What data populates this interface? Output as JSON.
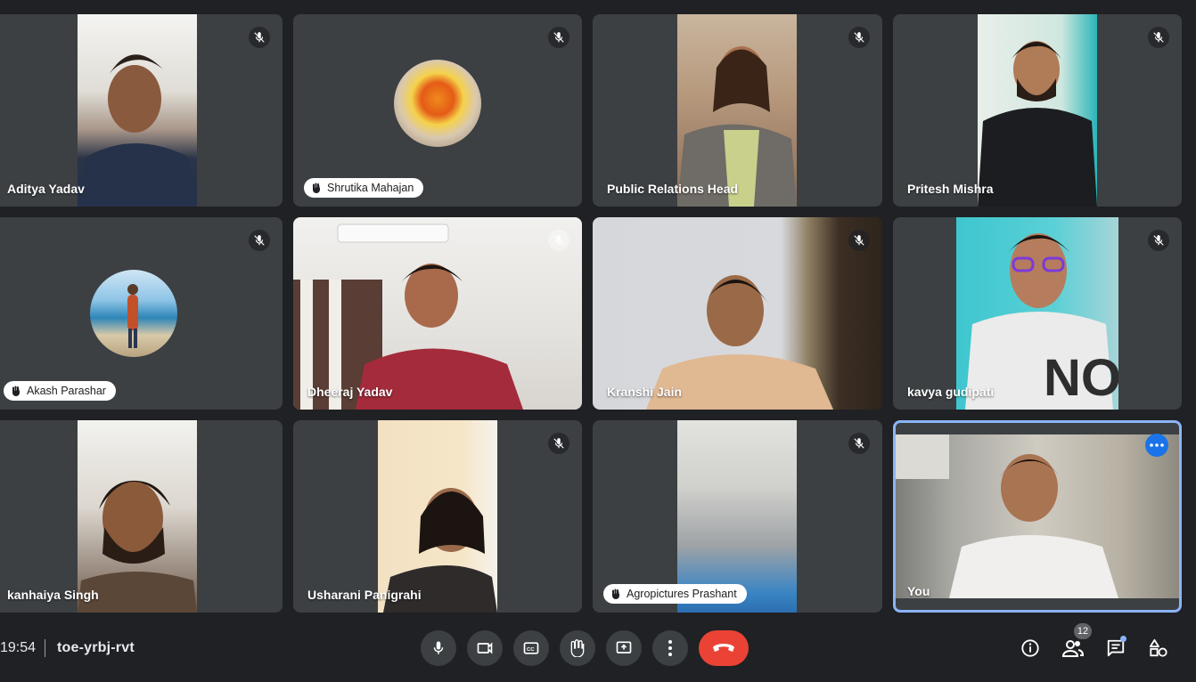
{
  "meeting": {
    "time": "19:54",
    "code": "toe-yrbj-rvt",
    "participant_count": "12"
  },
  "participants": [
    {
      "name": "Aditya Yadav",
      "muted": true
    },
    {
      "name": "Shrutika Mahajan",
      "muted": true,
      "hand_raised": true
    },
    {
      "name": "Public Relations Head",
      "muted": true
    },
    {
      "name": "Pritesh Mishra",
      "muted": true
    },
    {
      "name": "Akash Parashar",
      "muted": true,
      "hand_raised": true
    },
    {
      "name": "Dheeraj Yadav",
      "muted": true
    },
    {
      "name": "Kranshi Jain",
      "muted": true
    },
    {
      "name": "kavya gudipati",
      "muted": true
    },
    {
      "name": "kanhaiya Singh",
      "muted": false
    },
    {
      "name": "Usharani Panigrahi",
      "muted": true
    },
    {
      "name": "Agropictures Prashant",
      "muted": true,
      "hand_raised": true
    },
    {
      "name": "You",
      "muted": false
    }
  ],
  "controls": {
    "mic": "microphone-icon",
    "camera": "camera-icon",
    "captions": "captions-icon",
    "raise_hand": "raise-hand-icon",
    "present": "present-screen-icon",
    "more": "more-options-icon",
    "leave": "end-call-icon"
  },
  "colors": {
    "background": "#202124",
    "tile": "#3c4043",
    "end_call": "#ea4335",
    "self_border": "#8ab4f8",
    "accent": "#1a73e8"
  }
}
